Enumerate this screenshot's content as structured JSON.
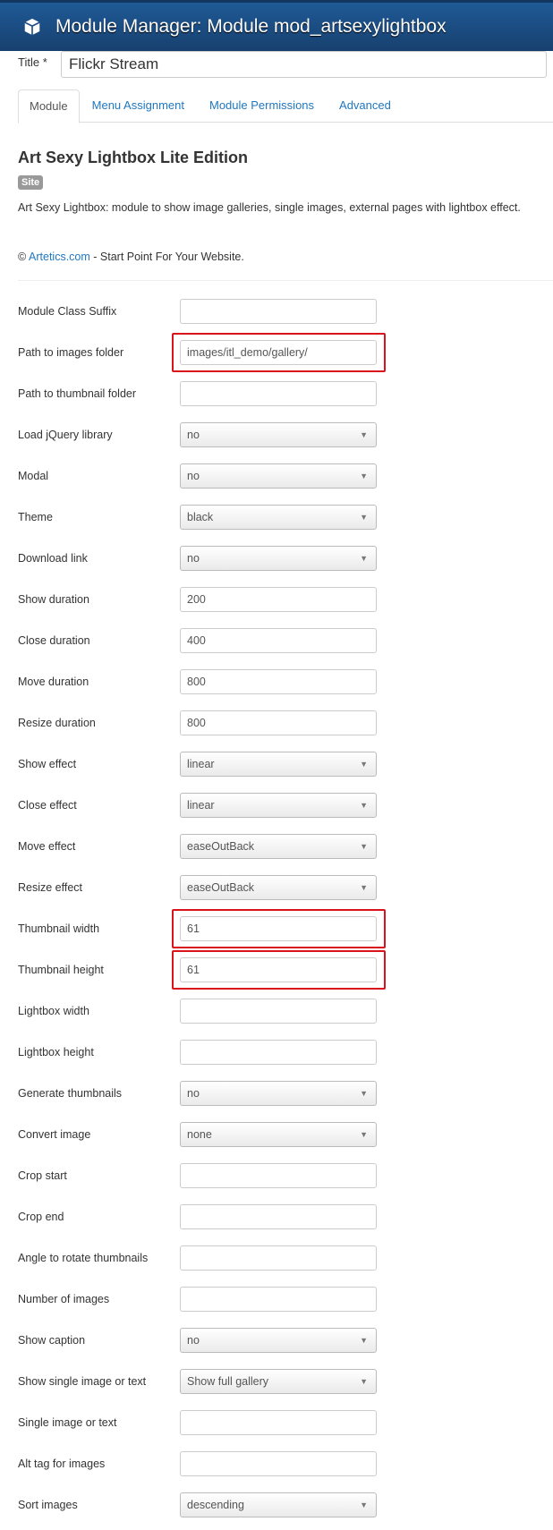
{
  "header": {
    "title": "Module Manager: Module mod_artsexylightbox",
    "icon": "cube-icon"
  },
  "title_field": {
    "label": "Title *",
    "value": "Flickr Stream"
  },
  "tabs": [
    {
      "label": "Module",
      "active": true
    },
    {
      "label": "Menu Assignment"
    },
    {
      "label": "Module Permissions"
    },
    {
      "label": "Advanced"
    }
  ],
  "module": {
    "heading": "Art Sexy Lightbox Lite Edition",
    "badge": "Site",
    "description": "Art Sexy Lightbox: module to show image galleries, single images, external pages with lightbox effect.",
    "copyright_symbol": "©",
    "link_text": "Artetics.com",
    "copyright_rest": " - Start Point For Your Website."
  },
  "highlight_color": "#d9121b",
  "fields": [
    {
      "label": "Module Class Suffix",
      "type": "text",
      "value": ""
    },
    {
      "label": "Path to images folder",
      "type": "text",
      "value": "images/itl_demo/gallery/",
      "highlighted": true
    },
    {
      "label": "Path to thumbnail folder",
      "type": "text",
      "value": ""
    },
    {
      "label": "Load jQuery library",
      "type": "select",
      "value": "no"
    },
    {
      "label": "Modal",
      "type": "select",
      "value": "no"
    },
    {
      "label": "Theme",
      "type": "select",
      "value": "black"
    },
    {
      "label": "Download link",
      "type": "select",
      "value": "no"
    },
    {
      "label": "Show duration",
      "type": "text",
      "value": "200"
    },
    {
      "label": "Close duration",
      "type": "text",
      "value": "400"
    },
    {
      "label": "Move duration",
      "type": "text",
      "value": "800"
    },
    {
      "label": "Resize duration",
      "type": "text",
      "value": "800"
    },
    {
      "label": "Show effect",
      "type": "select",
      "value": "linear"
    },
    {
      "label": "Close effect",
      "type": "select",
      "value": "linear"
    },
    {
      "label": "Move effect",
      "type": "select",
      "value": "easeOutBack"
    },
    {
      "label": "Resize effect",
      "type": "select",
      "value": "easeOutBack"
    },
    {
      "label": "Thumbnail width",
      "type": "text",
      "value": "61",
      "highlighted": true
    },
    {
      "label": "Thumbnail height",
      "type": "text",
      "value": "61",
      "highlighted": true
    },
    {
      "label": "Lightbox width",
      "type": "text",
      "value": ""
    },
    {
      "label": "Lightbox height",
      "type": "text",
      "value": ""
    },
    {
      "label": "Generate thumbnails",
      "type": "select",
      "value": "no"
    },
    {
      "label": "Convert image",
      "type": "select",
      "value": "none"
    },
    {
      "label": "Crop start",
      "type": "text",
      "value": ""
    },
    {
      "label": "Crop end",
      "type": "text",
      "value": ""
    },
    {
      "label": "Angle to rotate thumbnails",
      "type": "text",
      "value": ""
    },
    {
      "label": "Number of images",
      "type": "text",
      "value": ""
    },
    {
      "label": "Show caption",
      "type": "select",
      "value": "no"
    },
    {
      "label": "Show single image or text",
      "type": "select",
      "value": "Show full gallery"
    },
    {
      "label": "Single image or text",
      "type": "text",
      "value": ""
    },
    {
      "label": "Alt tag for images",
      "type": "text",
      "value": ""
    },
    {
      "label": "Sort images",
      "type": "select",
      "value": "descending"
    }
  ]
}
